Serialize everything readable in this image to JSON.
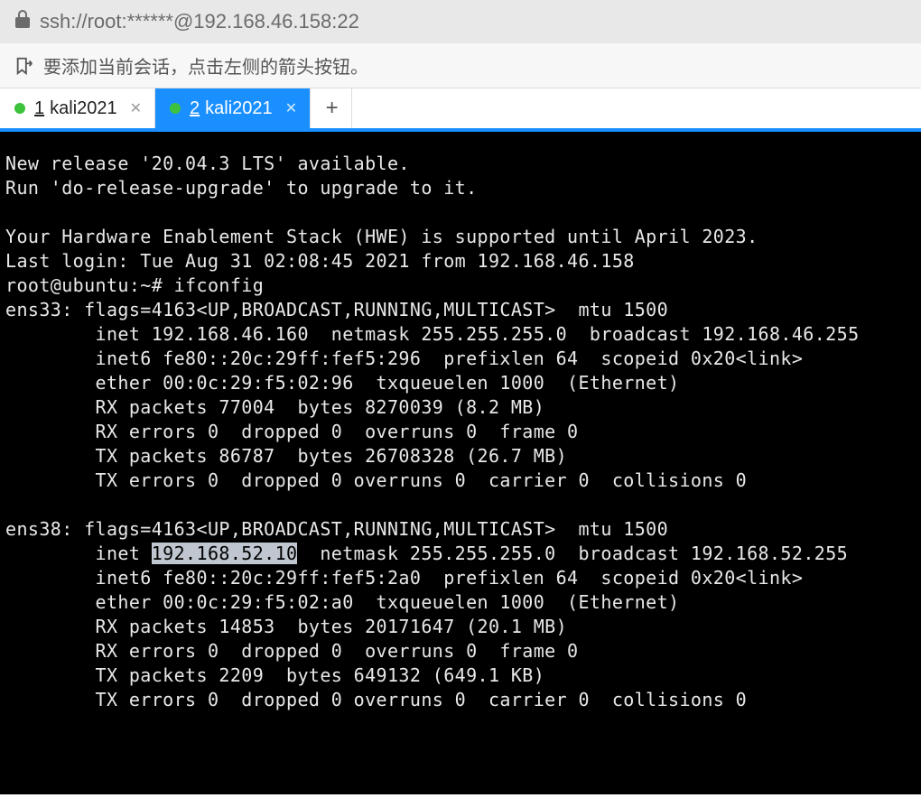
{
  "address_bar": {
    "url": "ssh://root:******@192.168.46.158:22"
  },
  "info_bar": {
    "message": "要添加当前会话，点击左侧的箭头按钮。"
  },
  "tabs": {
    "items": [
      {
        "num": "1",
        "label": "kali2021"
      },
      {
        "num": "2",
        "label": "kali2021"
      }
    ],
    "new_label": "+"
  },
  "terminal": {
    "line01": "New release '20.04.3 LTS' available.",
    "line02": "Run 'do-release-upgrade' to upgrade to it.",
    "blank1": "",
    "line03": "Your Hardware Enablement Stack (HWE) is supported until April 2023.",
    "line04": "Last login: Tue Aug 31 02:08:45 2021 from 192.168.46.158",
    "line05": "root@ubuntu:~# ifconfig",
    "line06": "ens33: flags=4163<UP,BROADCAST,RUNNING,MULTICAST>  mtu 1500",
    "line07": "        inet 192.168.46.160  netmask 255.255.255.0  broadcast 192.168.46.255",
    "line08": "        inet6 fe80::20c:29ff:fef5:296  prefixlen 64  scopeid 0x20<link>",
    "line09": "        ether 00:0c:29:f5:02:96  txqueuelen 1000  (Ethernet)",
    "line10": "        RX packets 77004  bytes 8270039 (8.2 MB)",
    "line11": "        RX errors 0  dropped 0  overruns 0  frame 0",
    "line12": "        TX packets 86787  bytes 26708328 (26.7 MB)",
    "line13": "        TX errors 0  dropped 0 overruns 0  carrier 0  collisions 0",
    "blank2": "",
    "line14": "ens38: flags=4163<UP,BROADCAST,RUNNING,MULTICAST>  mtu 1500",
    "line15a": "        inet ",
    "line15sel": "192.168.52.10",
    "line15b": "  netmask 255.255.255.0  broadcast 192.168.52.255",
    "line16": "        inet6 fe80::20c:29ff:fef5:2a0  prefixlen 64  scopeid 0x20<link>",
    "line17": "        ether 00:0c:29:f5:02:a0  txqueuelen 1000  (Ethernet)",
    "line18": "        RX packets 14853  bytes 20171647 (20.1 MB)",
    "line19": "        RX errors 0  dropped 0  overruns 0  frame 0",
    "line20": "        TX packets 2209  bytes 649132 (649.1 KB)",
    "line21": "        TX errors 0  dropped 0 overruns 0  carrier 0  collisions 0"
  }
}
